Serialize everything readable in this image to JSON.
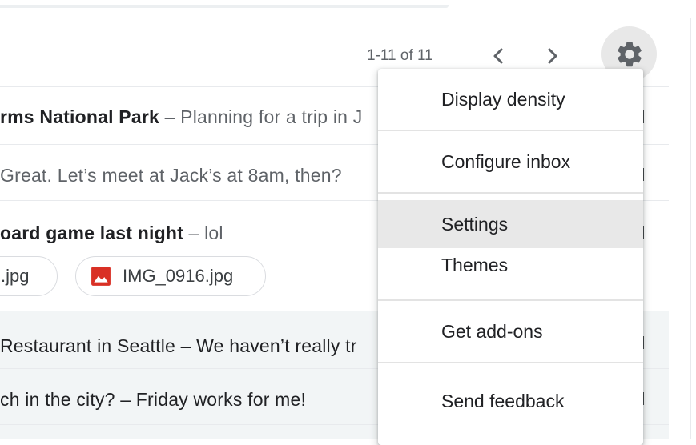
{
  "header": {
    "pagination": "1-11 of 11"
  },
  "icons": {
    "prev": "chevron-left-icon",
    "next": "chevron-right-icon",
    "settings": "gear-icon",
    "attachment": "image-icon"
  },
  "colors": {
    "accent_red": "#d93025",
    "menu_hover": "#e8e8e8",
    "row_gray": "#f2f5f6"
  },
  "emails": [
    {
      "subject": "rms National Park",
      "separator": " – ",
      "snippet": "Planning for a trip in J"
    },
    {
      "subject": "",
      "separator": "",
      "snippet": " Great. Let’s meet at Jack’s at 8am, then?"
    },
    {
      "subject": "oard game last night",
      "separator": " – ",
      "snippet": "lol"
    },
    {
      "subject": "",
      "separator": "",
      "snippet": "Restaurant in Seattle  – We haven’t really tr"
    },
    {
      "subject": "",
      "separator": "",
      "snippet": "ch in the city? – Friday works for me!"
    }
  ],
  "attachments": [
    {
      "name": ".jpg"
    },
    {
      "name": "IMG_0916.jpg"
    }
  ],
  "settings_menu": {
    "items": [
      {
        "label": "Display density"
      },
      {
        "label": "Configure inbox"
      },
      {
        "label": "Settings"
      },
      {
        "label": "Themes"
      },
      {
        "label": "Get add-ons"
      },
      {
        "label": "Send feedback"
      }
    ]
  }
}
